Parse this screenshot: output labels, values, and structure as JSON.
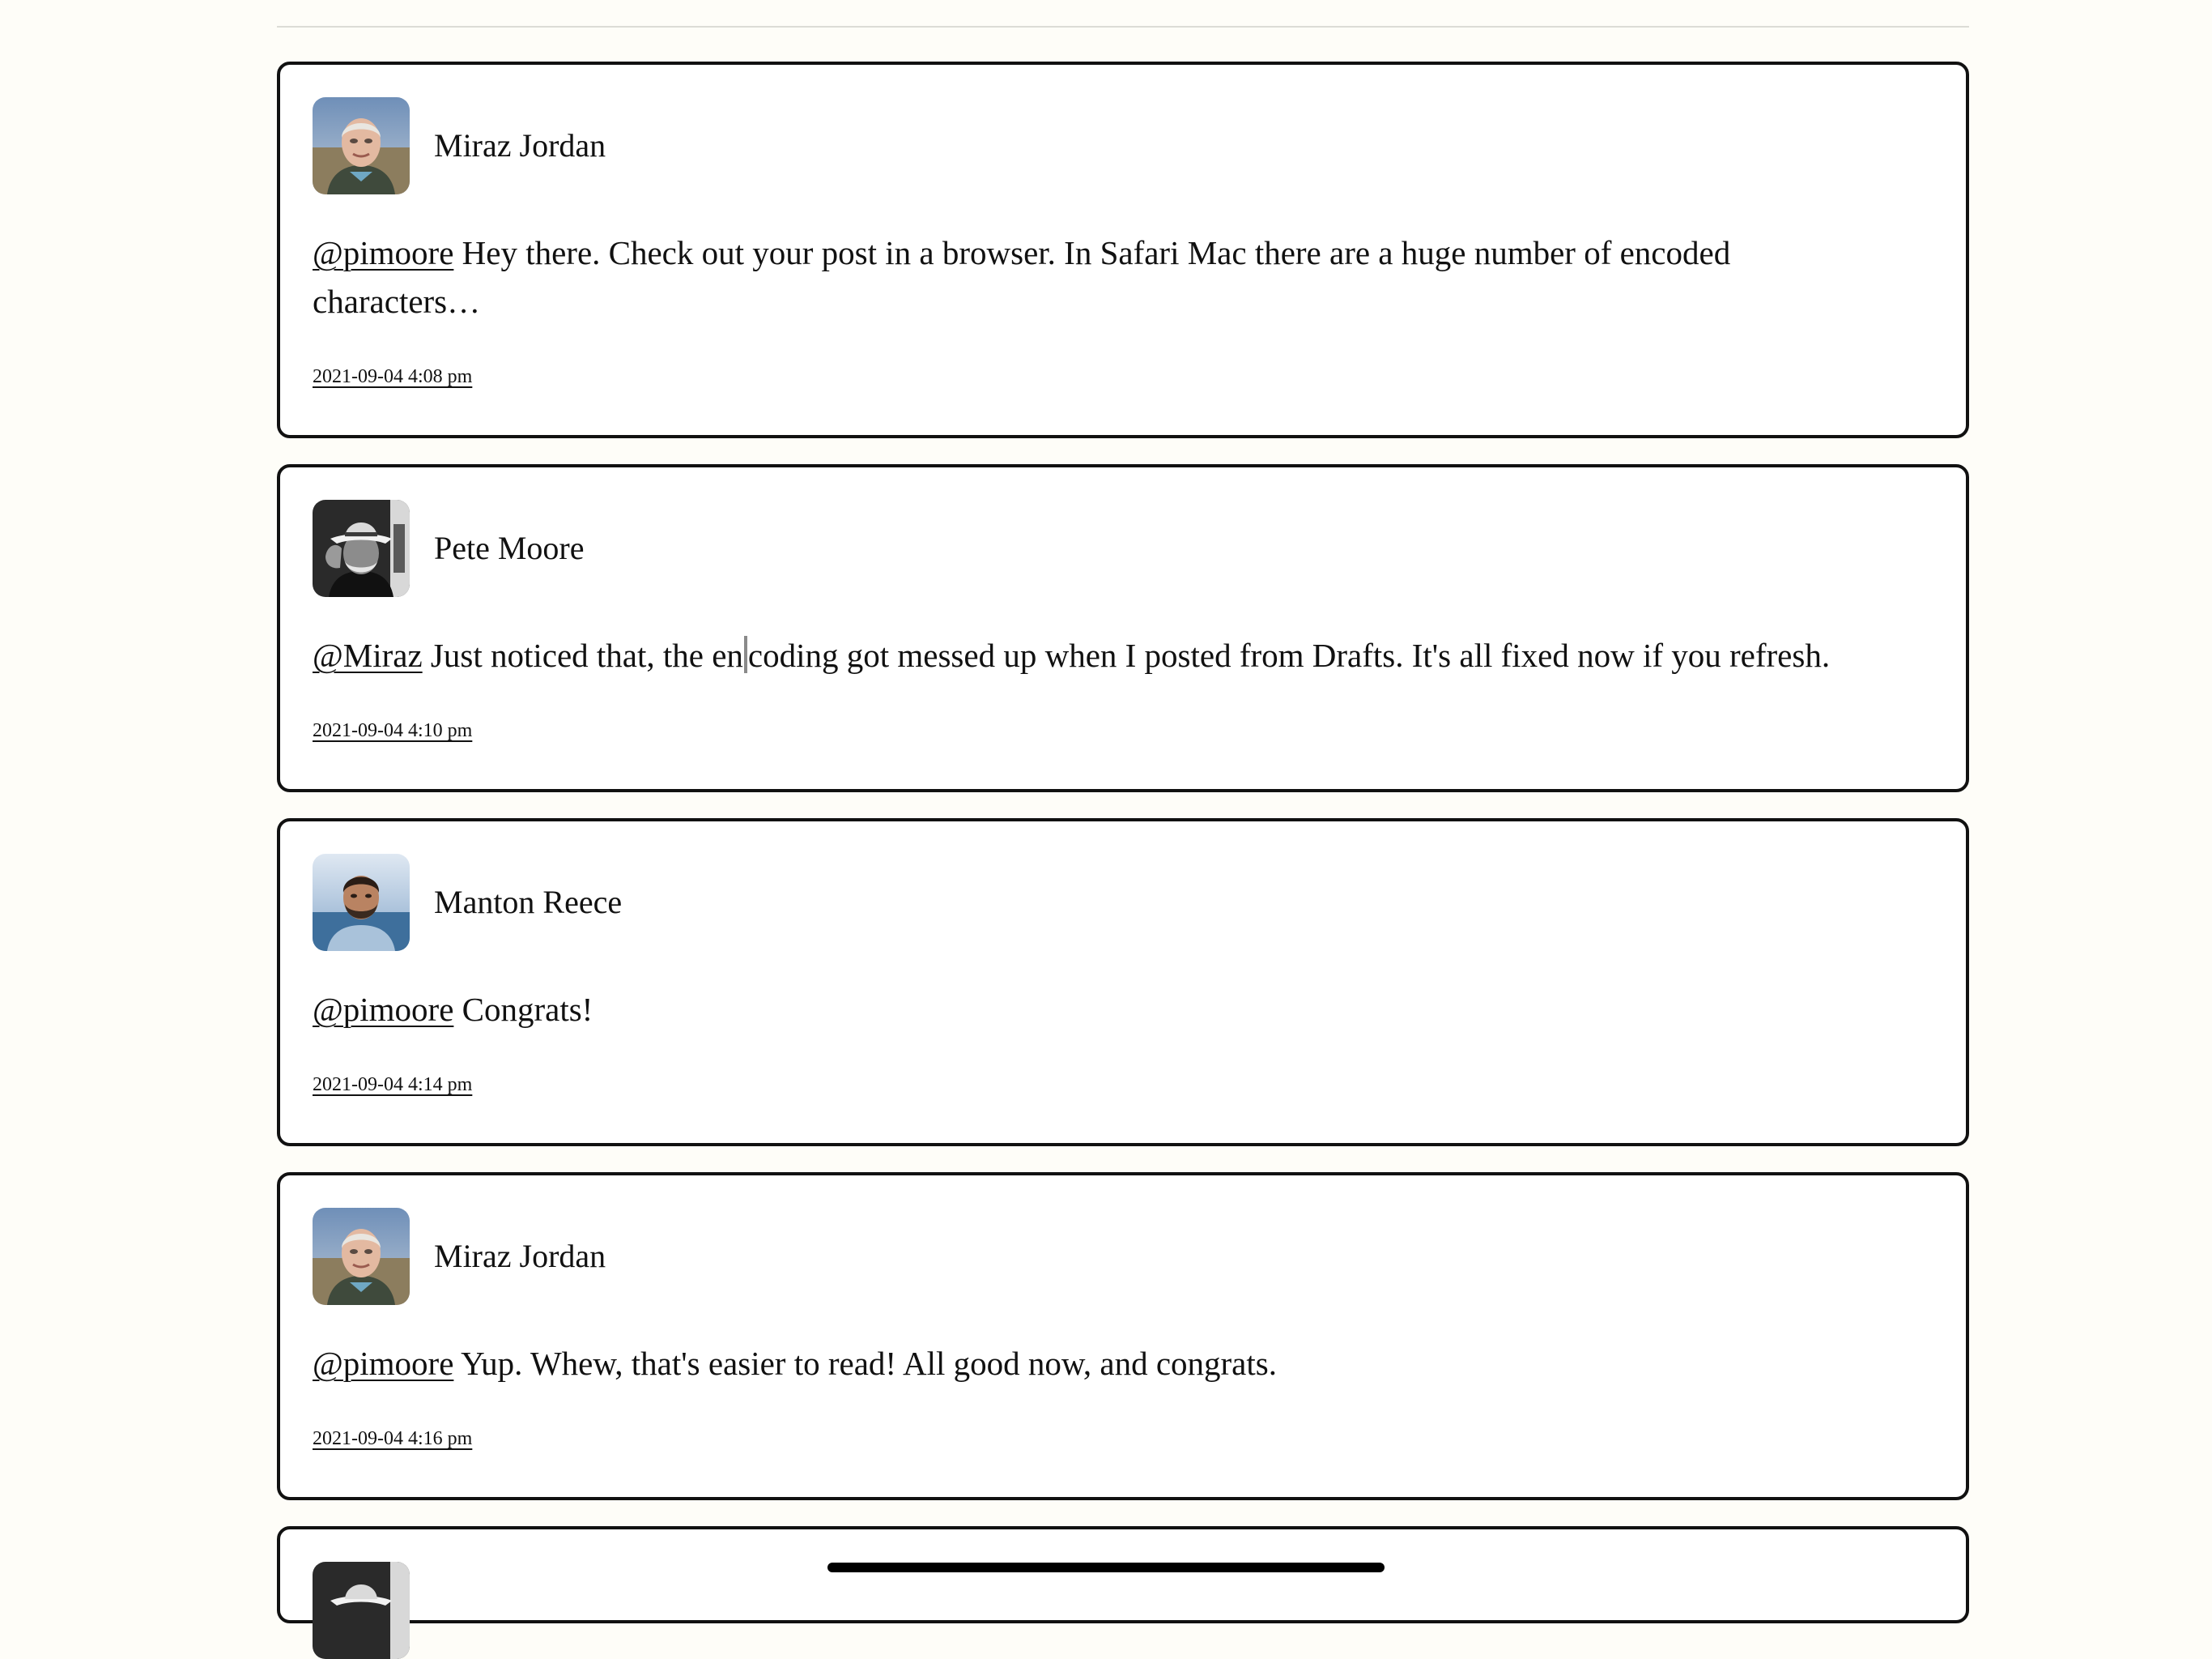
{
  "comments": [
    {
      "author": "Miraz Jordan",
      "mention": "@pimoore",
      "text": " Hey there. Check out your post in a browser. In Safari Mac there are a huge number of encoded characters…",
      "timestamp": "2021-09-04 4:08 pm",
      "avatar_icon": "photo-avatar-miraz-jordan"
    },
    {
      "author": "Pete Moore",
      "mention": "@Miraz",
      "text_before_cursor": " Just noticed that, the en",
      "text_after_cursor": "coding got messed up when I posted from Drafts. It's all fixed now if you refresh.",
      "timestamp": "2021-09-04 4:10 pm",
      "avatar_icon": "photo-avatar-pete-moore"
    },
    {
      "author": "Manton Reece",
      "mention": "@pimoore",
      "text": " Congrats!",
      "timestamp": "2021-09-04 4:14 pm",
      "avatar_icon": "photo-avatar-manton-reece"
    },
    {
      "author": "Miraz Jordan",
      "mention": "@pimoore",
      "text": " Yup. Whew, that's easier to read! All good now, and congrats.",
      "timestamp": "2021-09-04 4:16 pm",
      "avatar_icon": "photo-avatar-miraz-jordan"
    },
    {
      "avatar_icon": "photo-avatar-pete-moore"
    }
  ],
  "colors": {
    "background": "#fefdf8",
    "card_border": "#111111",
    "text": "#111111"
  }
}
